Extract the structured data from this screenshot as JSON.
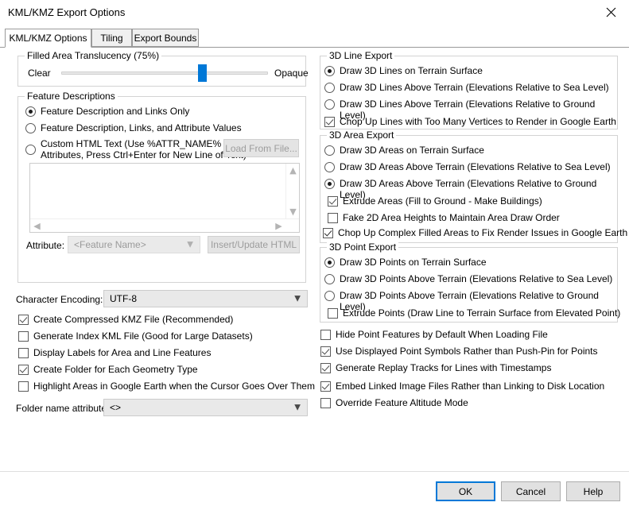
{
  "window": {
    "title": "KML/KMZ Export Options",
    "close_icon": "close-icon"
  },
  "tabs": [
    {
      "label": "KML/KMZ Options",
      "active": true
    },
    {
      "label": "Tiling",
      "active": false
    },
    {
      "label": "Export Bounds",
      "active": false
    }
  ],
  "translucency": {
    "group_label": "Filled Area Translucency (75%)",
    "min_label": "Clear",
    "max_label": "Opaque",
    "value_percent": 75
  },
  "feature_descriptions": {
    "group_label": "Feature Descriptions",
    "options": [
      {
        "label": "Feature Description and Links Only",
        "checked": true
      },
      {
        "label": "Feature Description, Links, and Attribute Values",
        "checked": false
      },
      {
        "label": "Custom HTML Text (Use %ATTR_NAME% for\nAttributes, Press Ctrl+Enter for New Line of Text)",
        "checked": false
      }
    ],
    "load_from_file_button": "Load From File...",
    "html_text_value": "",
    "attribute_label": "Attribute:",
    "attribute_value": "<Feature Name>",
    "insert_update_button": "Insert/Update HTML"
  },
  "encoding": {
    "label": "Character Encoding:",
    "value": "UTF-8"
  },
  "left_checkboxes": [
    {
      "label": "Create Compressed KMZ File (Recommended)",
      "checked": true
    },
    {
      "label": "Generate Index KML File (Good for Large Datasets)",
      "checked": false
    },
    {
      "label": "Display Labels for Area and Line Features",
      "checked": false
    },
    {
      "label": "Create Folder for Each Geometry Type",
      "checked": true
    },
    {
      "label": "Highlight Areas in Google Earth when the Cursor Goes Over Them",
      "checked": false
    }
  ],
  "folder_name": {
    "label": "Folder name attribute:",
    "value": "<>"
  },
  "line_export": {
    "group_label": "3D Line Export",
    "options": [
      {
        "label": "Draw 3D Lines on Terrain Surface",
        "checked": true
      },
      {
        "label": "Draw 3D Lines Above Terrain (Elevations Relative to Sea Level)",
        "checked": false
      },
      {
        "label": "Draw 3D Lines Above Terrain (Elevations Relative to Ground Level)",
        "checked": false
      }
    ],
    "checkboxes": [
      {
        "label": "Chop Up Lines with Too Many Vertices to Render in Google Earth",
        "checked": true
      }
    ]
  },
  "area_export": {
    "group_label": "3D Area Export",
    "options": [
      {
        "label": "Draw 3D Areas on Terrain Surface",
        "checked": false
      },
      {
        "label": "Draw 3D Areas Above Terrain (Elevations Relative to Sea Level)",
        "checked": false
      },
      {
        "label": "Draw 3D Areas Above Terrain (Elevations Relative to Ground Level)",
        "checked": true
      }
    ],
    "checkboxes": [
      {
        "label": "Extrude Areas (Fill to Ground - Make Buildings)",
        "checked": true
      },
      {
        "label": "Fake 2D Area Heights to Maintain Area Draw Order",
        "checked": false
      },
      {
        "label": "Chop Up Complex Filled Areas to Fix Render Issues in Google Earth",
        "checked": true
      }
    ]
  },
  "point_export": {
    "group_label": "3D Point Export",
    "options": [
      {
        "label": "Draw 3D Points on Terrain Surface",
        "checked": true
      },
      {
        "label": "Draw 3D Points Above Terrain (Elevations Relative to Sea Level)",
        "checked": false
      },
      {
        "label": "Draw 3D Points Above Terrain (Elevations Relative to Ground Level)",
        "checked": false
      }
    ],
    "checkboxes": [
      {
        "label": "Extrude Points (Draw Line to Terrain Surface from Elevated Point)",
        "checked": false
      }
    ]
  },
  "right_checkboxes": [
    {
      "label": "Hide Point Features by Default When Loading File",
      "checked": false
    },
    {
      "label": "Use Displayed Point Symbols Rather than Push-Pin for Points",
      "checked": true
    },
    {
      "label": "Generate Replay Tracks for Lines with Timestamps",
      "checked": true
    },
    {
      "label": "Embed Linked Image Files Rather than Linking to Disk Location",
      "checked": true
    },
    {
      "label": "Override Feature Altitude Mode",
      "checked": false
    }
  ],
  "buttons": {
    "ok": "OK",
    "cancel": "Cancel",
    "help": "Help"
  },
  "colors": {
    "accent": "#0078d7",
    "group_border": "#d3d3d3",
    "button_face": "#e1e1e1"
  }
}
